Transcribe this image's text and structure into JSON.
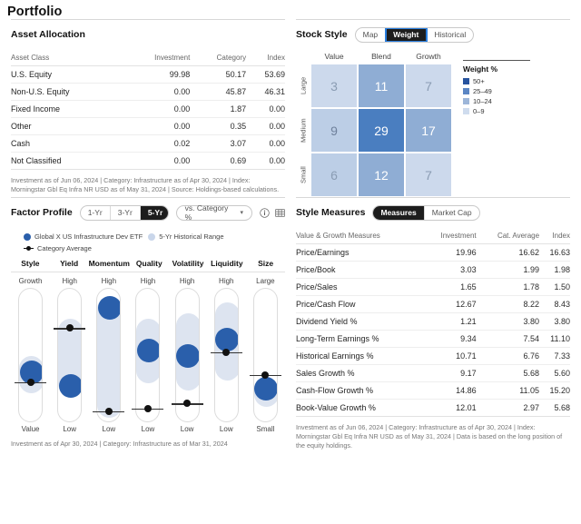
{
  "page": {
    "title": "Portfolio"
  },
  "asset_allocation": {
    "title": "Asset Allocation",
    "columns": [
      "Asset Class",
      "Investment",
      "Category",
      "Index"
    ],
    "rows": [
      {
        "label": "U.S. Equity",
        "investment": "99.98",
        "category": "50.17",
        "index": "53.69"
      },
      {
        "label": "Non-U.S. Equity",
        "investment": "0.00",
        "category": "45.87",
        "index": "46.31"
      },
      {
        "label": "Fixed Income",
        "investment": "0.00",
        "category": "1.87",
        "index": "0.00"
      },
      {
        "label": "Other",
        "investment": "0.00",
        "category": "0.35",
        "index": "0.00"
      },
      {
        "label": "Cash",
        "investment": "0.02",
        "category": "3.07",
        "index": "0.00"
      },
      {
        "label": "Not Classified",
        "investment": "0.00",
        "category": "0.69",
        "index": "0.00"
      }
    ],
    "footnote": "Investment as of Jun 06, 2024 | Category: Infrastructure as of Apr 30, 2024 | Index: Morningstar Gbl Eq Infra NR USD as of May 31, 2024 | Source: Holdings-based calculations."
  },
  "stock_style": {
    "title": "Stock Style",
    "tabs": [
      {
        "label": "Map",
        "active": false
      },
      {
        "label": "Weight",
        "active": true
      },
      {
        "label": "Historical",
        "active": false
      }
    ],
    "col_labels": [
      "Value",
      "Blend",
      "Growth"
    ],
    "row_labels": [
      "Large",
      "Medium",
      "Small"
    ],
    "chart_data": {
      "type": "heatmap",
      "title": "Stock Style — Weight %",
      "x": [
        "Value",
        "Blend",
        "Growth"
      ],
      "y": [
        "Large",
        "Medium",
        "Small"
      ],
      "values": [
        [
          3,
          11,
          7
        ],
        [
          9,
          29,
          17
        ],
        [
          6,
          12,
          7
        ]
      ],
      "cell_colors": [
        [
          "#ccd9ec",
          "#8fadd4",
          "#ccd9ec"
        ],
        [
          "#bcceE6",
          "#4a7ec0",
          "#8fadd4"
        ],
        [
          "#bcceE6",
          "#8fadd4",
          "#ccd9ec"
        ]
      ],
      "text_colors": [
        [
          "#8a9cb3",
          "#ffffff",
          "#8a9cb3"
        ],
        [
          "#6f819c",
          "#ffffff",
          "#ffffff"
        ],
        [
          "#8a9cb3",
          "#ffffff",
          "#8a9cb3"
        ]
      ],
      "legend_title": "Weight %",
      "legend": [
        {
          "label": "50+",
          "color": "#27539e"
        },
        {
          "label": "25–49",
          "color": "#5b86c4"
        },
        {
          "label": "10–24",
          "color": "#9db6d9"
        },
        {
          "label": "0–9",
          "color": "#cfdcee"
        }
      ]
    }
  },
  "factor_profile": {
    "title": "Factor Profile",
    "period_tabs": [
      {
        "label": "1-Yr",
        "active": false
      },
      {
        "label": "3-Yr",
        "active": false
      },
      {
        "label": "5-Yr",
        "active": true
      }
    ],
    "compare_select": "vs. Category %",
    "icons": {
      "info": "info-icon",
      "table": "table-icon"
    },
    "legend": [
      {
        "label": "Global X US Infrastructure Dev ETF",
        "color": "#2a5fab",
        "type": "dot"
      },
      {
        "label": "5-Yr Historical Range",
        "color": "#c9d6ea",
        "type": "dot"
      },
      {
        "label": "Category Average",
        "color": "#111111",
        "type": "marker"
      }
    ],
    "chart_data": {
      "type": "scatter",
      "title": "Factor Profile vs. Category % (5-Yr)",
      "categories": [
        "Style",
        "Yield",
        "Momentum",
        "Quality",
        "Volatility",
        "Liquidity",
        "Size"
      ],
      "top_labels": [
        "Growth",
        "High",
        "High",
        "High",
        "High",
        "High",
        "Large"
      ],
      "bottom_labels": [
        "Value",
        "Low",
        "Low",
        "Low",
        "Low",
        "Low",
        "Small"
      ],
      "ylim": [
        0,
        100
      ],
      "series": [
        {
          "name": "Global X US Infrastructure Dev ETF",
          "values": [
            38,
            28,
            86,
            54,
            50,
            62,
            26
          ]
        },
        {
          "name": "Category Average",
          "values": [
            30,
            70,
            8,
            10,
            14,
            52,
            35
          ]
        }
      ],
      "ranges": [
        {
          "category": "Style",
          "low": 22,
          "high": 50
        },
        {
          "category": "Yield",
          "low": 20,
          "high": 78
        },
        {
          "category": "Momentum",
          "low": 4,
          "high": 94
        },
        {
          "category": "Quality",
          "low": 30,
          "high": 78
        },
        {
          "category": "Volatility",
          "low": 24,
          "high": 82
        },
        {
          "category": "Liquidity",
          "low": 32,
          "high": 90
        },
        {
          "category": "Size",
          "low": 12,
          "high": 34
        }
      ]
    },
    "footnote": "Investment as of Apr 30, 2024 | Category: Infrastructure as of Mar 31, 2024"
  },
  "style_measures": {
    "title": "Style Measures",
    "tabs": [
      {
        "label": "Measures",
        "active": true
      },
      {
        "label": "Market Cap",
        "active": false
      }
    ],
    "columns": [
      "Value & Growth Measures",
      "Investment",
      "Cat. Average",
      "Index"
    ],
    "rows": [
      {
        "label": "Price/Earnings",
        "investment": "19.96",
        "cat_average": "16.62",
        "index": "16.63"
      },
      {
        "label": "Price/Book",
        "investment": "3.03",
        "cat_average": "1.99",
        "index": "1.98"
      },
      {
        "label": "Price/Sales",
        "investment": "1.65",
        "cat_average": "1.78",
        "index": "1.50"
      },
      {
        "label": "Price/Cash Flow",
        "investment": "12.67",
        "cat_average": "8.22",
        "index": "8.43"
      },
      {
        "label": "Dividend Yield %",
        "investment": "1.21",
        "cat_average": "3.80",
        "index": "3.80"
      },
      {
        "label": "Long-Term Earnings %",
        "investment": "9.34",
        "cat_average": "7.54",
        "index": "11.10"
      },
      {
        "label": "Historical Earnings %",
        "investment": "10.71",
        "cat_average": "6.76",
        "index": "7.33"
      },
      {
        "label": "Sales Growth %",
        "investment": "9.17",
        "cat_average": "5.68",
        "index": "5.60"
      },
      {
        "label": "Cash-Flow Growth %",
        "investment": "14.86",
        "cat_average": "11.05",
        "index": "15.20"
      },
      {
        "label": "Book-Value Growth %",
        "investment": "12.01",
        "cat_average": "2.97",
        "index": "5.68"
      }
    ],
    "footnote": "Investment as of Jun 06, 2024 | Category: Infrastructure as of Apr 30, 2024 | Index: Morningstar Gbl Eq Infra NR USD as of May 31, 2024 | Data is based on the long position of the equity holdings."
  }
}
